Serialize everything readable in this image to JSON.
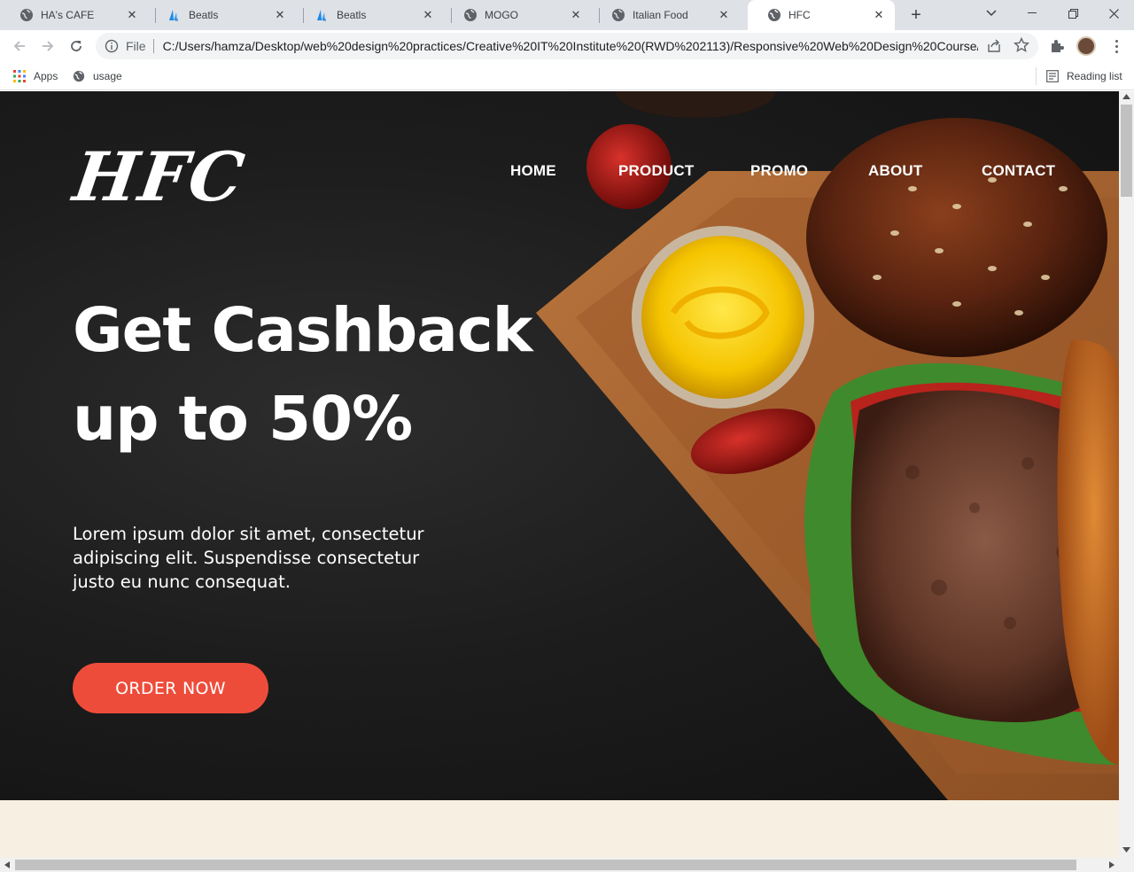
{
  "browser": {
    "tabs": [
      {
        "title": "HA's CAFE",
        "icon": "globe-icon"
      },
      {
        "title": "Beatls",
        "icon": "beatls-favicon"
      },
      {
        "title": "Beatls",
        "icon": "beatls-favicon"
      },
      {
        "title": "MOGO",
        "icon": "globe-icon"
      },
      {
        "title": "Italian Food",
        "icon": "globe-icon"
      },
      {
        "title": "HFC",
        "icon": "globe-icon",
        "active": true
      }
    ],
    "address": {
      "scheme_label": "File",
      "url": "C:/Users/hamza/Desktop/web%20design%20practices/Creative%20IT%20Institute%20(RWD%202113)/Responsive%20Web%20Design%20Course/H..."
    },
    "bookmarks": [
      {
        "label": "Apps",
        "icon": "apps-grid-icon"
      },
      {
        "label": "usage",
        "icon": "globe-icon"
      }
    ],
    "reading_list_label": "Reading list"
  },
  "site": {
    "logo": "HFC",
    "nav": [
      "HOME",
      "PRODUCT",
      "PROMO",
      "ABOUT",
      "CONTACT"
    ],
    "headline_line1": "Get Cashback",
    "headline_line2": "up to 50%",
    "lede": "Lorem ipsum dolor sit amet, consectetur adipiscing elit. Suspendisse consectetur justo eu nunc consequat.",
    "cta": "ORDER NOW"
  },
  "colors": {
    "hero_bg": "#1d1d1d",
    "cta_bg": "#ee4c3a",
    "section_bg": "#f7efe2",
    "tabstrip_bg": "#dee1e6"
  }
}
